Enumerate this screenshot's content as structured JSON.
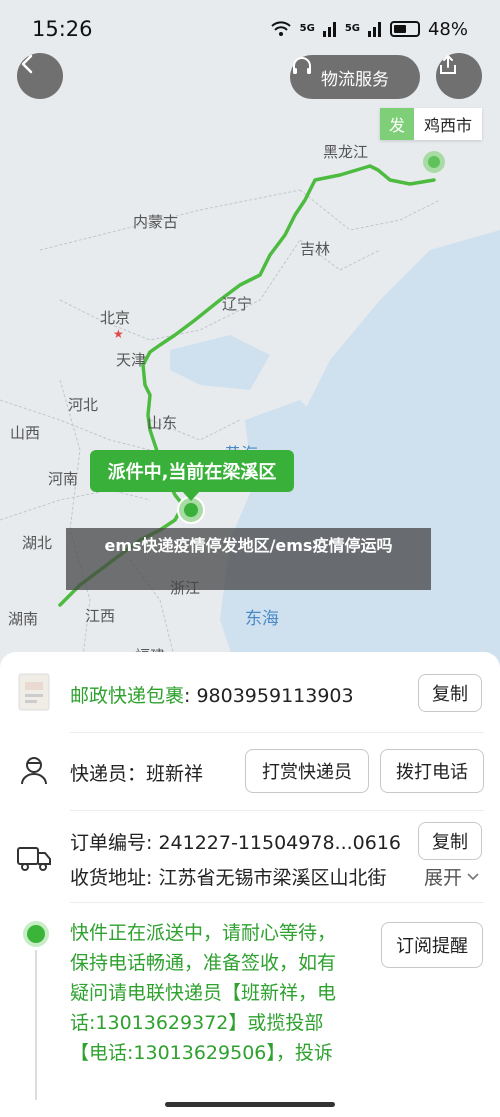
{
  "status_bar": {
    "time": "15:26",
    "signal1": "5G",
    "signal2": "5G",
    "battery": "48%"
  },
  "map": {
    "service_label": "物流服务",
    "origin_badge": "发",
    "origin_city": "鸡西市",
    "delivery_status": "派件中,当前在梁溪区",
    "labels": {
      "heilongjiang": "黑龙江",
      "neimenggu": "内蒙古",
      "jilin": "吉林",
      "beijing": "北京",
      "tianjin": "天津",
      "liaoning": "辽宁",
      "hebei": "河北",
      "shanxi": "山西",
      "shandong": "山东",
      "henan": "河南",
      "huangsea": "黄海",
      "hubei": "湖北",
      "hunan": "湖南",
      "jiangxi": "江西",
      "zhejiang": "浙江",
      "donghai": "东海",
      "fujian": "福建"
    }
  },
  "caption_overlay": "ems快递疫情停发地区/ems疫情停运吗",
  "panel": {
    "package": {
      "label": "邮政快递包裹",
      "number": ": 9803959113903",
      "copy_btn": "复制"
    },
    "courier": {
      "label": "快递员：班新祥",
      "tip_btn": "打赏快递员",
      "call_btn": "拨打电话"
    },
    "order": {
      "order_label": "订单编号: 241227-11504978...0616",
      "copy_btn": "复制",
      "address_label": "收货地址: 江苏省无锡市梁溪区山北街",
      "expand_label": "展开"
    },
    "status": {
      "text": "快件正在派送中，请耐心等待，保持电话畅通，准备签收，如有疑问请电联快递员【班新祥，电话:13013629372】或揽投部【电话:13013629506】，投诉",
      "subscribe_btn": "订阅提醒"
    }
  },
  "colors": {
    "route": "#4cbb3f",
    "accent_green": "#38b039",
    "sea": "#cfe0ee",
    "land": "#eceef0"
  }
}
